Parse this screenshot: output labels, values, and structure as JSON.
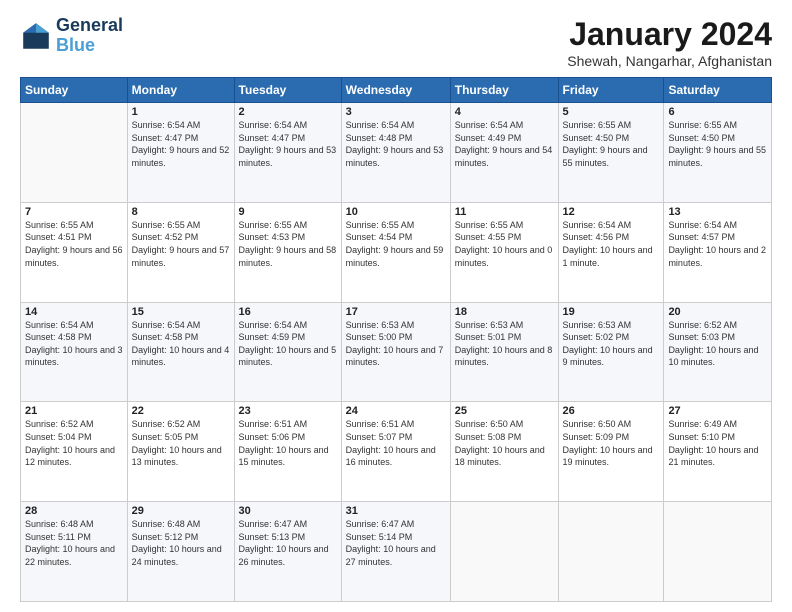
{
  "logo": {
    "line1": "General",
    "line2": "Blue"
  },
  "title": "January 2024",
  "subtitle": "Shewah, Nangarhar, Afghanistan",
  "weekdays": [
    "Sunday",
    "Monday",
    "Tuesday",
    "Wednesday",
    "Thursday",
    "Friday",
    "Saturday"
  ],
  "weeks": [
    [
      {
        "day": "",
        "sunrise": "",
        "sunset": "",
        "daylight": ""
      },
      {
        "day": "1",
        "sunrise": "Sunrise: 6:54 AM",
        "sunset": "Sunset: 4:47 PM",
        "daylight": "Daylight: 9 hours and 52 minutes."
      },
      {
        "day": "2",
        "sunrise": "Sunrise: 6:54 AM",
        "sunset": "Sunset: 4:47 PM",
        "daylight": "Daylight: 9 hours and 53 minutes."
      },
      {
        "day": "3",
        "sunrise": "Sunrise: 6:54 AM",
        "sunset": "Sunset: 4:48 PM",
        "daylight": "Daylight: 9 hours and 53 minutes."
      },
      {
        "day": "4",
        "sunrise": "Sunrise: 6:54 AM",
        "sunset": "Sunset: 4:49 PM",
        "daylight": "Daylight: 9 hours and 54 minutes."
      },
      {
        "day": "5",
        "sunrise": "Sunrise: 6:55 AM",
        "sunset": "Sunset: 4:50 PM",
        "daylight": "Daylight: 9 hours and 55 minutes."
      },
      {
        "day": "6",
        "sunrise": "Sunrise: 6:55 AM",
        "sunset": "Sunset: 4:50 PM",
        "daylight": "Daylight: 9 hours and 55 minutes."
      }
    ],
    [
      {
        "day": "7",
        "sunrise": "Sunrise: 6:55 AM",
        "sunset": "Sunset: 4:51 PM",
        "daylight": "Daylight: 9 hours and 56 minutes."
      },
      {
        "day": "8",
        "sunrise": "Sunrise: 6:55 AM",
        "sunset": "Sunset: 4:52 PM",
        "daylight": "Daylight: 9 hours and 57 minutes."
      },
      {
        "day": "9",
        "sunrise": "Sunrise: 6:55 AM",
        "sunset": "Sunset: 4:53 PM",
        "daylight": "Daylight: 9 hours and 58 minutes."
      },
      {
        "day": "10",
        "sunrise": "Sunrise: 6:55 AM",
        "sunset": "Sunset: 4:54 PM",
        "daylight": "Daylight: 9 hours and 59 minutes."
      },
      {
        "day": "11",
        "sunrise": "Sunrise: 6:55 AM",
        "sunset": "Sunset: 4:55 PM",
        "daylight": "Daylight: 10 hours and 0 minutes."
      },
      {
        "day": "12",
        "sunrise": "Sunrise: 6:54 AM",
        "sunset": "Sunset: 4:56 PM",
        "daylight": "Daylight: 10 hours and 1 minute."
      },
      {
        "day": "13",
        "sunrise": "Sunrise: 6:54 AM",
        "sunset": "Sunset: 4:57 PM",
        "daylight": "Daylight: 10 hours and 2 minutes."
      }
    ],
    [
      {
        "day": "14",
        "sunrise": "Sunrise: 6:54 AM",
        "sunset": "Sunset: 4:58 PM",
        "daylight": "Daylight: 10 hours and 3 minutes."
      },
      {
        "day": "15",
        "sunrise": "Sunrise: 6:54 AM",
        "sunset": "Sunset: 4:58 PM",
        "daylight": "Daylight: 10 hours and 4 minutes."
      },
      {
        "day": "16",
        "sunrise": "Sunrise: 6:54 AM",
        "sunset": "Sunset: 4:59 PM",
        "daylight": "Daylight: 10 hours and 5 minutes."
      },
      {
        "day": "17",
        "sunrise": "Sunrise: 6:53 AM",
        "sunset": "Sunset: 5:00 PM",
        "daylight": "Daylight: 10 hours and 7 minutes."
      },
      {
        "day": "18",
        "sunrise": "Sunrise: 6:53 AM",
        "sunset": "Sunset: 5:01 PM",
        "daylight": "Daylight: 10 hours and 8 minutes."
      },
      {
        "day": "19",
        "sunrise": "Sunrise: 6:53 AM",
        "sunset": "Sunset: 5:02 PM",
        "daylight": "Daylight: 10 hours and 9 minutes."
      },
      {
        "day": "20",
        "sunrise": "Sunrise: 6:52 AM",
        "sunset": "Sunset: 5:03 PM",
        "daylight": "Daylight: 10 hours and 10 minutes."
      }
    ],
    [
      {
        "day": "21",
        "sunrise": "Sunrise: 6:52 AM",
        "sunset": "Sunset: 5:04 PM",
        "daylight": "Daylight: 10 hours and 12 minutes."
      },
      {
        "day": "22",
        "sunrise": "Sunrise: 6:52 AM",
        "sunset": "Sunset: 5:05 PM",
        "daylight": "Daylight: 10 hours and 13 minutes."
      },
      {
        "day": "23",
        "sunrise": "Sunrise: 6:51 AM",
        "sunset": "Sunset: 5:06 PM",
        "daylight": "Daylight: 10 hours and 15 minutes."
      },
      {
        "day": "24",
        "sunrise": "Sunrise: 6:51 AM",
        "sunset": "Sunset: 5:07 PM",
        "daylight": "Daylight: 10 hours and 16 minutes."
      },
      {
        "day": "25",
        "sunrise": "Sunrise: 6:50 AM",
        "sunset": "Sunset: 5:08 PM",
        "daylight": "Daylight: 10 hours and 18 minutes."
      },
      {
        "day": "26",
        "sunrise": "Sunrise: 6:50 AM",
        "sunset": "Sunset: 5:09 PM",
        "daylight": "Daylight: 10 hours and 19 minutes."
      },
      {
        "day": "27",
        "sunrise": "Sunrise: 6:49 AM",
        "sunset": "Sunset: 5:10 PM",
        "daylight": "Daylight: 10 hours and 21 minutes."
      }
    ],
    [
      {
        "day": "28",
        "sunrise": "Sunrise: 6:48 AM",
        "sunset": "Sunset: 5:11 PM",
        "daylight": "Daylight: 10 hours and 22 minutes."
      },
      {
        "day": "29",
        "sunrise": "Sunrise: 6:48 AM",
        "sunset": "Sunset: 5:12 PM",
        "daylight": "Daylight: 10 hours and 24 minutes."
      },
      {
        "day": "30",
        "sunrise": "Sunrise: 6:47 AM",
        "sunset": "Sunset: 5:13 PM",
        "daylight": "Daylight: 10 hours and 26 minutes."
      },
      {
        "day": "31",
        "sunrise": "Sunrise: 6:47 AM",
        "sunset": "Sunset: 5:14 PM",
        "daylight": "Daylight: 10 hours and 27 minutes."
      },
      {
        "day": "",
        "sunrise": "",
        "sunset": "",
        "daylight": ""
      },
      {
        "day": "",
        "sunrise": "",
        "sunset": "",
        "daylight": ""
      },
      {
        "day": "",
        "sunrise": "",
        "sunset": "",
        "daylight": ""
      }
    ]
  ]
}
